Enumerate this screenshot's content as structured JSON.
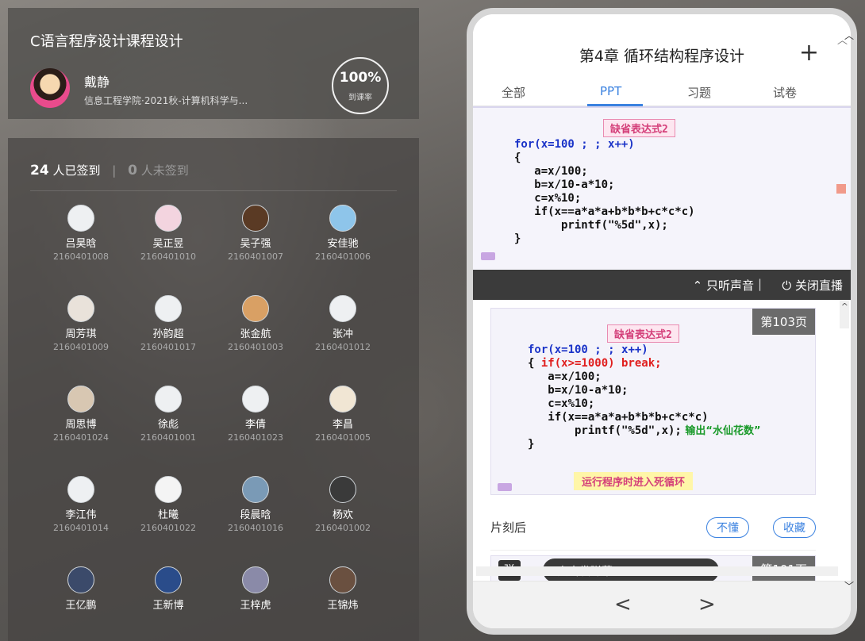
{
  "course": {
    "title": "C语言程序设计课程设计",
    "teacher_name": "戴静",
    "teacher_dept": "信息工程学院·2021秋-计算机科学与...",
    "rate_value": "100%",
    "rate_label": "到课率"
  },
  "signin": {
    "signed_count": "24",
    "signed_label": "人已签到",
    "separator": "|",
    "unsigned_count": "0",
    "unsigned_label": "人未签到"
  },
  "students": [
    {
      "name": "吕昊晗",
      "id": "2160401008"
    },
    {
      "name": "吴正昱",
      "id": "2160401010"
    },
    {
      "name": "吴子强",
      "id": "2160401007"
    },
    {
      "name": "安佳驰",
      "id": "2160401006"
    },
    {
      "name": "周芳琪",
      "id": "2160401009"
    },
    {
      "name": "孙韵超",
      "id": "2160401017"
    },
    {
      "name": "张金航",
      "id": "2160401003"
    },
    {
      "name": "张冲",
      "id": "2160401012"
    },
    {
      "name": "周思博",
      "id": "2160401024"
    },
    {
      "name": "徐彪",
      "id": "2160401001"
    },
    {
      "name": "李倩",
      "id": "2160401023"
    },
    {
      "name": "李昌",
      "id": "2160401005"
    },
    {
      "name": "李江伟",
      "id": "2160401014"
    },
    {
      "name": "杜曦",
      "id": "2160401022"
    },
    {
      "name": "段晨晗",
      "id": "2160401016"
    },
    {
      "name": "杨欢",
      "id": "2160401002"
    },
    {
      "name": "王亿鹏",
      "id": ""
    },
    {
      "name": "王新博",
      "id": ""
    },
    {
      "name": "王梓虎",
      "id": ""
    },
    {
      "name": "王锦炜",
      "id": ""
    }
  ],
  "phone": {
    "title": "第4章 循环结构程序设计",
    "plus_symbol": "+",
    "tabs": [
      "全部",
      "PPT",
      "习题",
      "试卷"
    ],
    "active_tab": "PPT",
    "live_audio_only": "只听声音",
    "live_divider": "|",
    "live_close": "关闭直播",
    "slide1": {
      "tag": "缺省表达式2",
      "code_for_a": "for(x=100 ; ",
      "code_for_b": "; x++)",
      "code_lines": [
        "{",
        "   a=x/100;",
        "   b=x/10-a*10;",
        "   c=x%10;",
        "   if(x==a*a*a+b*b*b+c*c*c)",
        "       printf(\"%5d\",x);",
        "}"
      ]
    },
    "slide2": {
      "page": "第103页",
      "tag": "缺省表达式2",
      "code_for_a": "for(x=100 ; ",
      "code_for_b": "; x++)",
      "code_brace": "{ ",
      "code_break": "if(x>=1000) break;",
      "code_lines": [
        "   a=x/100;",
        "   b=x/10-a*10;",
        "   c=x%10;",
        "   if(x==a*a*a+b*b*b+c*c*c)"
      ],
      "code_printf": "       printf(\"%5d\",x);",
      "code_comment": " 输出“水仙花数”",
      "code_close": "}",
      "note": "运行程序时进入死循环"
    },
    "footer_time": "片刻后",
    "btn_dont_understand": "不懂",
    "btn_favorite": "收藏",
    "slide3_page": "第101页",
    "danmu_toggle": "弹",
    "danmu_placeholder": "点击发弹幕 ...",
    "prev": "<",
    "next": ">"
  },
  "colors": {
    "accent": "#3b82e0",
    "code_blue": "#1a33c8",
    "code_red": "#e01e1e",
    "code_green": "#1a9a2a",
    "tag_pink": "#d4407a"
  }
}
